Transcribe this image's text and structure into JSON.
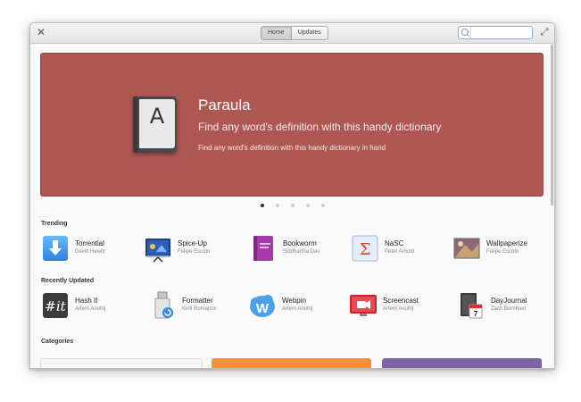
{
  "titlebar": {
    "tabs": [
      {
        "label": "Home"
      },
      {
        "label": "Updates"
      }
    ],
    "search_placeholder": ""
  },
  "banner": {
    "title": "Paraula",
    "subtitle": "Find any word's definition with this handy dictionary",
    "description": "Find any word's definition with this handy dictionary in hand",
    "icon_letter": "A",
    "background": "#ae5753"
  },
  "carousel": {
    "count": 5,
    "active": 0
  },
  "trending": {
    "title": "Trending",
    "apps": [
      {
        "name": "Torrential",
        "author": "David Hewitt",
        "icon": "torrential-icon"
      },
      {
        "name": "Spice-Up",
        "author": "Felipe Escoto",
        "icon": "presentation-icon"
      },
      {
        "name": "Bookworm",
        "author": "Siddhartha Das",
        "icon": "book-icon"
      },
      {
        "name": "NaSC",
        "author": "Peter Arnold",
        "icon": "sigma-icon"
      },
      {
        "name": "Wallpaperize",
        "author": "Felipe Escoto",
        "icon": "wallpaper-icon"
      }
    ]
  },
  "recently_updated": {
    "title": "Recently Updated",
    "apps": [
      {
        "name": "Hash It",
        "author": "Artem Anufrij",
        "icon": "hash-icon"
      },
      {
        "name": "Formatter",
        "author": "Kirill Romanov",
        "icon": "usb-drive-icon"
      },
      {
        "name": "Webpin",
        "author": "Artem Anufrij",
        "icon": "webpin-icon"
      },
      {
        "name": "Screencast",
        "author": "Artem Anufrij",
        "icon": "screencast-icon"
      },
      {
        "name": "DayJournal",
        "author": "Zach Burnham",
        "icon": "journal-icon",
        "day": "7"
      }
    ]
  },
  "categories": {
    "title": "Categories",
    "tiles": [
      {
        "name": "category-tile-1",
        "color": "#f7f7f7"
      },
      {
        "name": "category-tile-2",
        "color": "#f2913d"
      },
      {
        "name": "category-tile-3",
        "color": "#7e64a6"
      }
    ]
  },
  "colors": {
    "accent": "#3689e6",
    "banner": "#ae5753"
  }
}
